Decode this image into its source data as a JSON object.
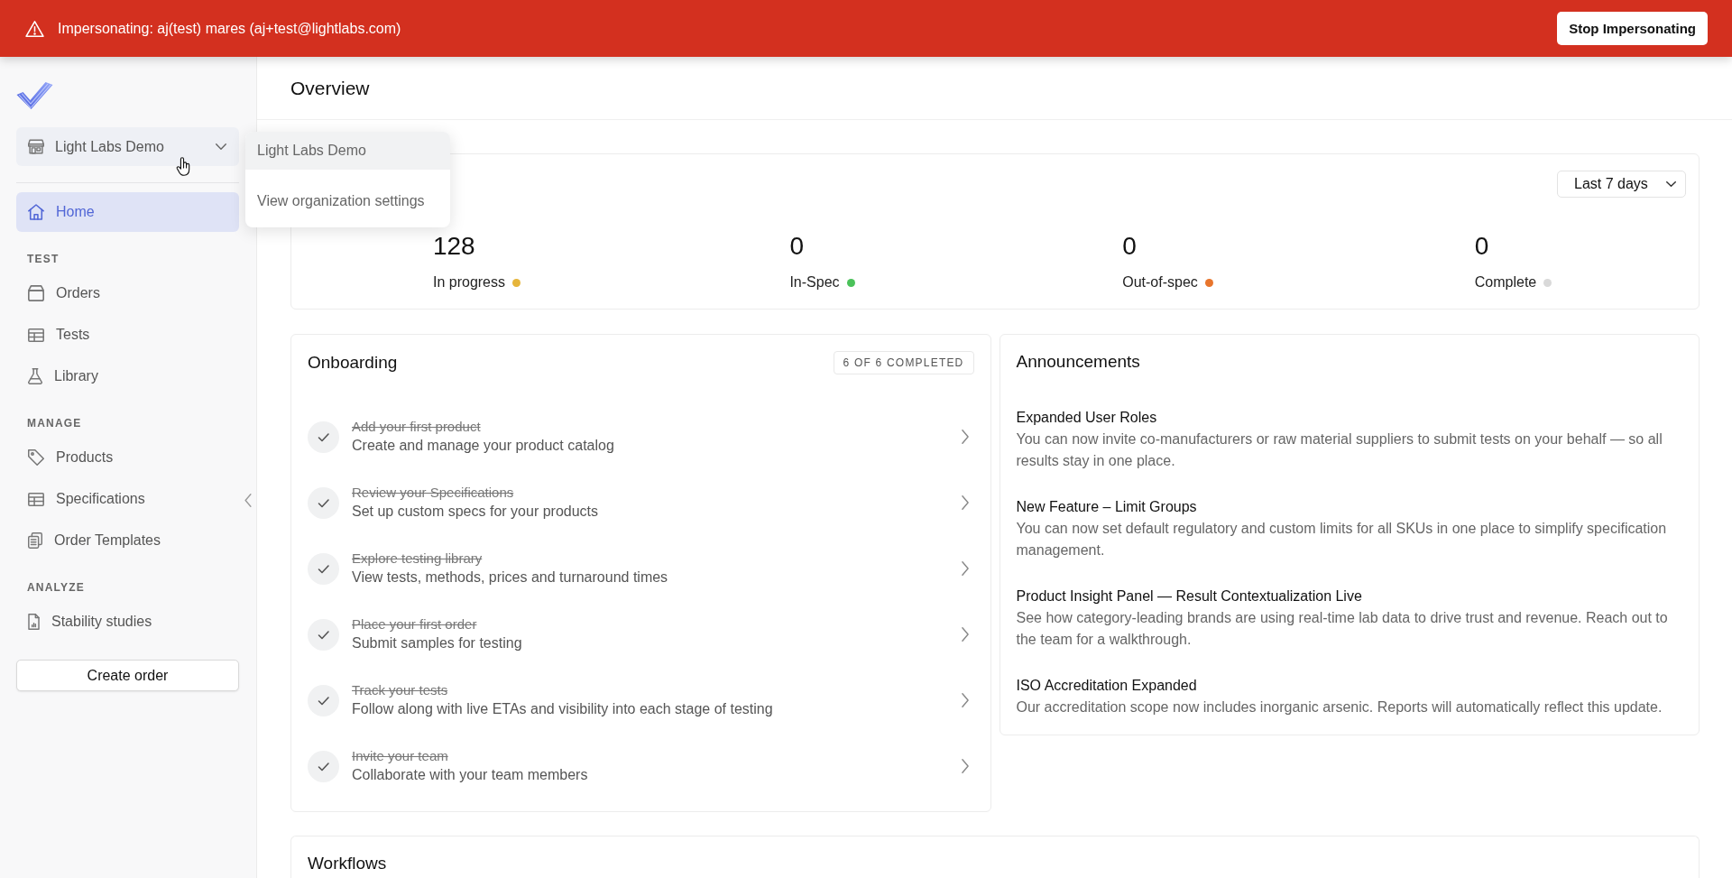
{
  "banner": {
    "message": "Impersonating: aj(test) mares (aj+test@lightlabs.com)",
    "button": "Stop Impersonating"
  },
  "sidebar": {
    "org_selector": {
      "name": "Light Labs Demo",
      "expanded": true
    },
    "org_menu": [
      {
        "label": "Light Labs Demo",
        "selected": true
      },
      {
        "label": "View organization settings",
        "selected": false
      }
    ],
    "sections": [
      {
        "items": [
          {
            "label": "Home",
            "selected": true
          }
        ]
      },
      {
        "heading": "TEST",
        "items": [
          {
            "label": "Orders",
            "selected": false
          },
          {
            "label": "Tests",
            "selected": false
          },
          {
            "label": "Library",
            "selected": false
          }
        ]
      },
      {
        "heading": "MANAGE",
        "items": [
          {
            "label": "Products",
            "selected": false
          },
          {
            "label": "Specifications",
            "selected": false
          },
          {
            "label": "Order Templates",
            "selected": false
          }
        ]
      },
      {
        "heading": "ANALYZE",
        "items": [
          {
            "label": "Stability studies",
            "selected": false
          }
        ]
      }
    ],
    "create_button": "Create order"
  },
  "main": {
    "title": "Overview",
    "stats": {
      "range": "Last 7 days",
      "items": [
        {
          "value": "128",
          "label": "In progress",
          "color": "#e6b53b"
        },
        {
          "value": "0",
          "label": "In-Spec",
          "color": "#4bc25a"
        },
        {
          "value": "0",
          "label": "Out-of-spec",
          "color": "#e8752c"
        },
        {
          "value": "0",
          "label": "Complete",
          "color": "#d9d9d9"
        }
      ]
    },
    "onboarding": {
      "title": "Onboarding",
      "badge": "6 OF 6 COMPLETED",
      "steps": [
        {
          "title": "Add your first product",
          "description": "Create and manage your product catalog",
          "completed": true
        },
        {
          "title": "Review your Specifications",
          "description": "Set up custom specs for your products",
          "completed": true
        },
        {
          "title": "Explore testing library",
          "description": "View tests, methods, prices and turnaround times",
          "completed": true
        },
        {
          "title": "Place your first order",
          "description": "Submit samples for testing",
          "completed": true
        },
        {
          "title": "Track your tests",
          "description": "Follow along with live ETAs and visibility into each stage of testing",
          "completed": true
        },
        {
          "title": "Invite your team",
          "description": "Collaborate with your team members",
          "completed": true
        }
      ]
    },
    "announcements": {
      "title": "Announcements",
      "items": [
        {
          "title": "Expanded User Roles",
          "body": "You can now invite co-manufacturers or raw material suppliers to submit tests on your behalf — so all results stay in one place."
        },
        {
          "title": "New Feature – Limit Groups",
          "body": "You can now set default regulatory and custom limits for all SKUs in one place to simplify specification management."
        },
        {
          "title": "Product Insight Panel — Result Contextualization Live",
          "body": "See how category-leading brands are using real-time lab data to drive trust and revenue. Reach out to the team for a walkthrough."
        },
        {
          "title": "ISO Accreditation Expanded",
          "body": "Our accreditation scope now includes inorganic arsenic. Reports will automatically reflect this update."
        }
      ]
    },
    "workflows": {
      "title": "Workflows"
    }
  }
}
